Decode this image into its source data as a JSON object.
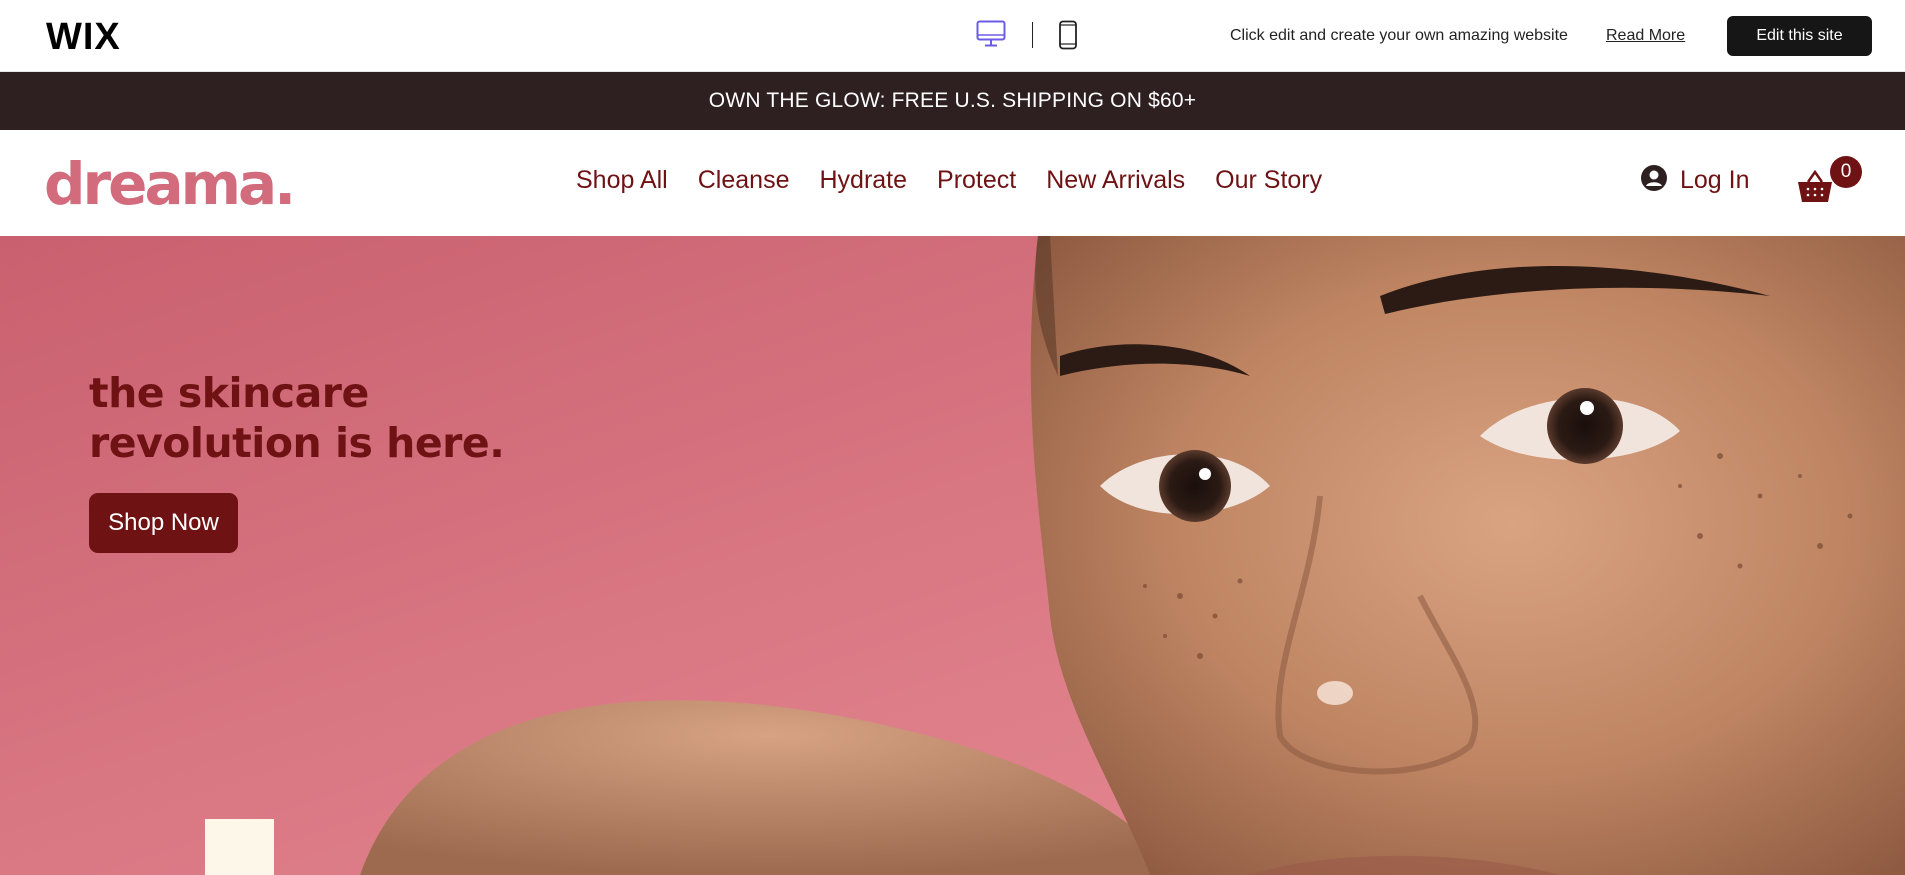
{
  "wix_bar": {
    "logo": "WIX",
    "promo_text": "Click edit and create your own amazing website",
    "read_more": "Read More",
    "edit_button": "Edit this site",
    "device_icons": [
      "desktop-icon",
      "mobile-icon"
    ],
    "active_device_color": "#6b5ce7"
  },
  "announcement": {
    "text": "OWN THE GLOW: FREE U.S. SHIPPING ON $60+"
  },
  "header": {
    "brand": "dreama.",
    "nav": [
      "Shop All",
      "Cleanse",
      "Hydrate",
      "Protect",
      "New Arrivals",
      "Our Story"
    ],
    "login_label": "Log In",
    "cart_count": "0"
  },
  "hero": {
    "title_line1": "the skincare",
    "title_line2": "revolution is here.",
    "cta": "Shop Now"
  },
  "colors": {
    "brand_pink": "#d26b7c",
    "maroon": "#6e1214",
    "announcement_bg": "#2e1f20",
    "hero_bg": "#cf6b79"
  }
}
